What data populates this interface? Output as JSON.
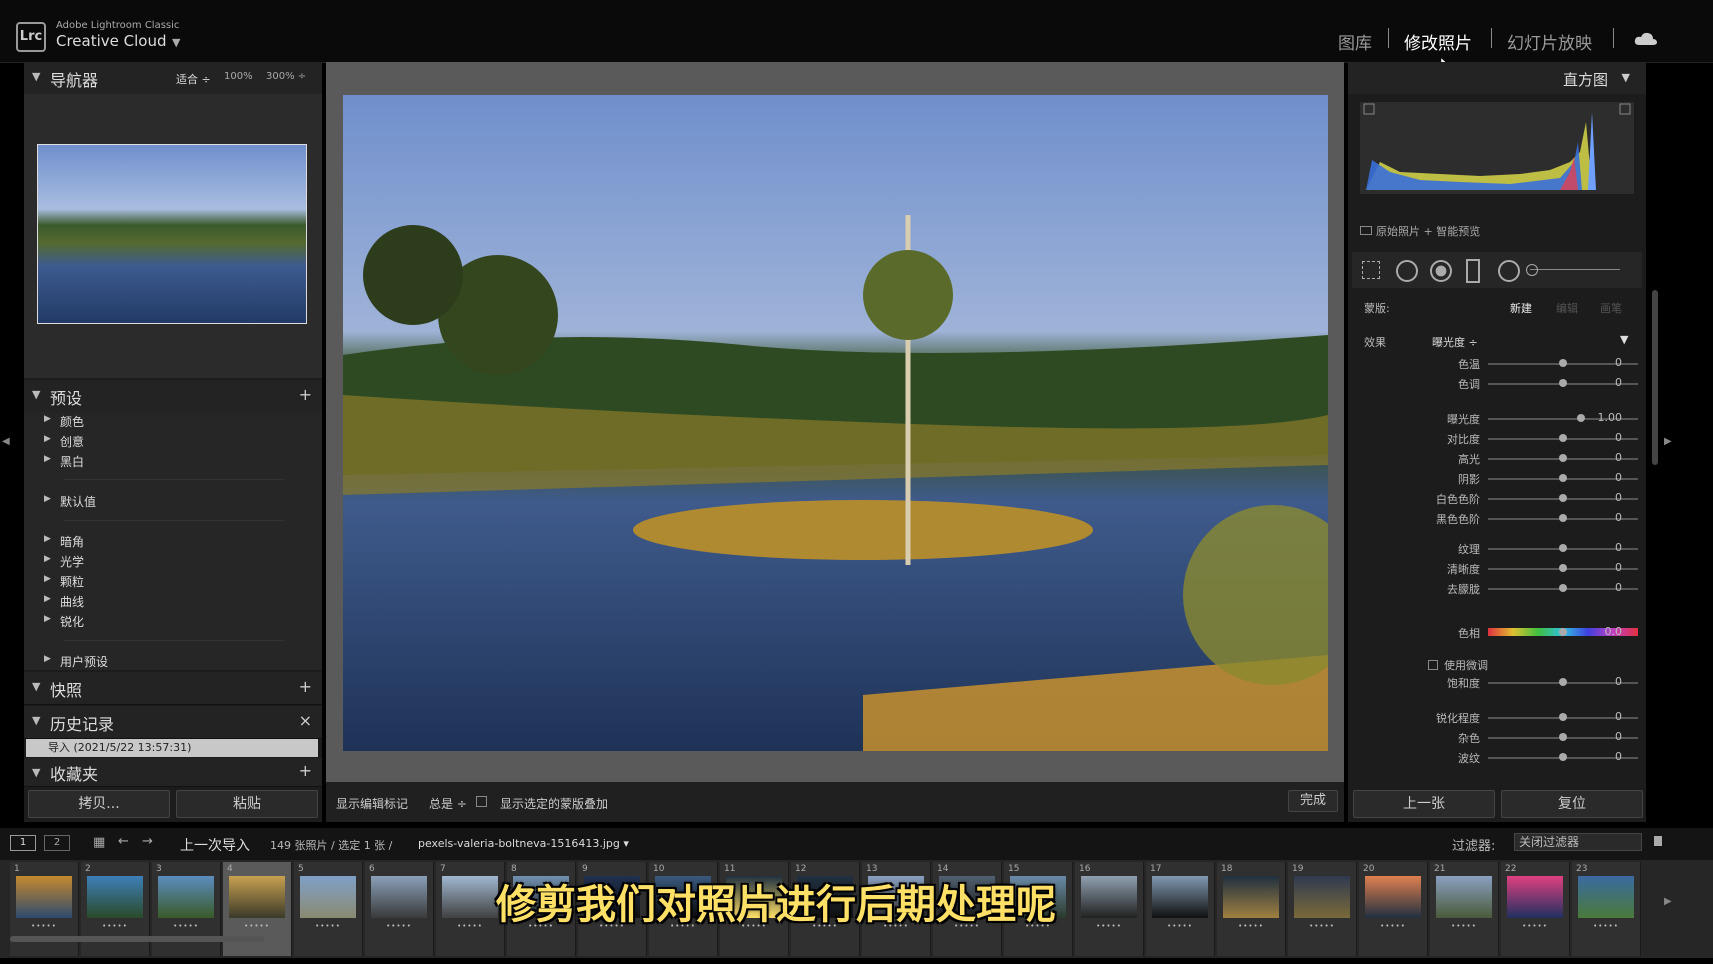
{
  "app": {
    "brand": "Lrc",
    "small_title": "Adobe Lightroom Classic",
    "big_title": "Creative Cloud",
    "caret": "▼"
  },
  "modules": [
    "图库",
    "修改照片",
    "幻灯片放映"
  ],
  "active_module": "修改照片",
  "navigator": {
    "title": "导航器",
    "fit": "适合 ÷",
    "z1": "100%",
    "z2": "300% ÷"
  },
  "presets": {
    "title": "预设",
    "add": "+",
    "items": [
      "颜色",
      "创意",
      "黑白",
      "默认值",
      "暗角",
      "光学",
      "颗粒",
      "曲线",
      "锐化",
      "用户预设"
    ]
  },
  "snapshots": {
    "title": "快照",
    "add": "+"
  },
  "history": {
    "title": "历史记录",
    "close": "×",
    "entry": "导入 (2021/5/22 13:57:31)"
  },
  "collections": {
    "title": "收藏夹",
    "add": "+"
  },
  "left_buttons": {
    "copy": "拷贝...",
    "paste": "粘贴"
  },
  "toolbar": {
    "show_edit": "显示编辑标记",
    "always": "总是 ÷",
    "overlay": "显示选定的蒙版叠加",
    "done": "完成"
  },
  "histogram": {
    "title": "直方图",
    "caret": "▼",
    "caption": "原始照片 + 智能预览"
  },
  "mask": {
    "label": "蒙版:",
    "new": "新建",
    "b1": "编辑",
    "b2": "画笔",
    "effect_label": "效果",
    "effect_value": "曝光度 ÷",
    "caret": "▼"
  },
  "sliders": [
    {
      "label": "色温",
      "value": "0",
      "pos": 0.5
    },
    {
      "label": "色调",
      "value": "0",
      "pos": 0.5
    },
    {
      "label": "曝光度",
      "value": "1.00",
      "pos": 0.62
    },
    {
      "label": "对比度",
      "value": "0",
      "pos": 0.5
    },
    {
      "label": "高光",
      "value": "0",
      "pos": 0.5
    },
    {
      "label": "阴影",
      "value": "0",
      "pos": 0.5
    },
    {
      "label": "白色色阶",
      "value": "0",
      "pos": 0.5
    },
    {
      "label": "黑色色阶",
      "value": "0",
      "pos": 0.5
    },
    {
      "label": "纹理",
      "value": "0",
      "pos": 0.5
    },
    {
      "label": "清晰度",
      "value": "0",
      "pos": 0.5
    },
    {
      "label": "去朦胧",
      "value": "0",
      "pos": 0.5
    },
    {
      "label": "色相",
      "value": "0.0",
      "pos": 0.5
    },
    {
      "label": "饱和度",
      "value": "0",
      "pos": 0.5
    },
    {
      "label": "锐化程度",
      "value": "0",
      "pos": 0.5
    },
    {
      "label": "杂色",
      "value": "0",
      "pos": 0.5
    },
    {
      "label": "波纹",
      "value": "0",
      "pos": 0.5
    }
  ],
  "fine_adjust": "使用微调",
  "right_buttons": {
    "prev": "上一张",
    "reset": "复位"
  },
  "filmbar": {
    "p1": "1",
    "p2": "2",
    "source": "上一次导入",
    "info": "149 张照片 / 选定 1 张 /",
    "file": "pexels-valeria-boltneva-1516413.jpg ▾",
    "filter_label": "过滤器:",
    "filter_value": "关闭过滤器"
  },
  "thumbnails": [
    "1",
    "2",
    "3",
    "4",
    "5",
    "6",
    "7",
    "8",
    "9",
    "10",
    "11",
    "12",
    "13",
    "14",
    "15",
    "16",
    "17",
    "18",
    "19",
    "20",
    "21",
    "22",
    "23"
  ],
  "subtitle": "修剪我们对照片进行后期处理呢",
  "colors": {
    "accent": "#ffffff",
    "subtitle": "#ffe066",
    "panel": "#1c1c1c"
  }
}
